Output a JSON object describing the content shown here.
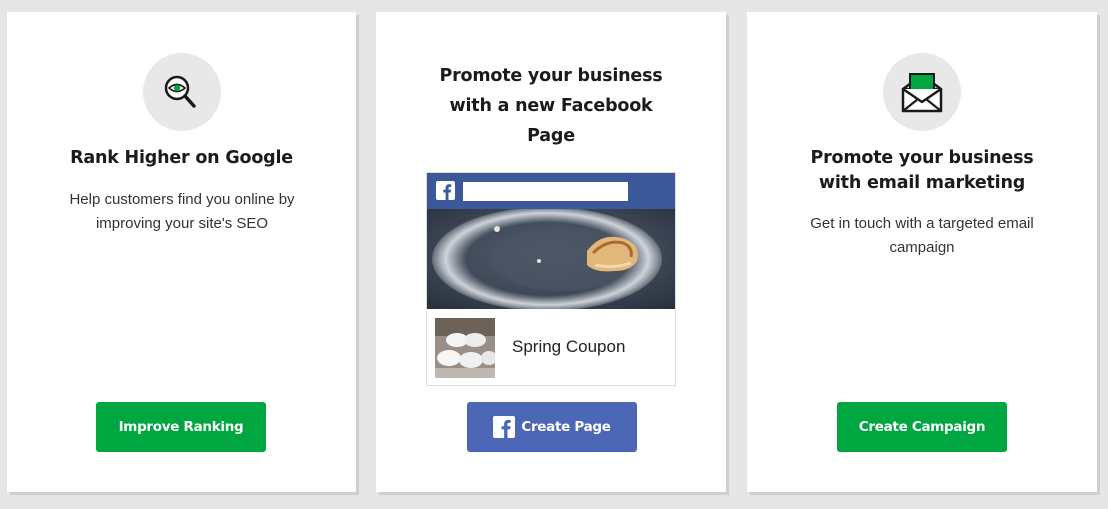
{
  "cards": [
    {
      "icon": "magnifier-eye-icon",
      "heading": "Rank Higher on Google",
      "description": "Help customers find you online by improving your site's SEO",
      "button_label": "Improve Ranking",
      "button_color": "#00a63f"
    },
    {
      "heading": "Promote your business with a new Facebook Page",
      "preview": {
        "coupon_label": "Spring Coupon"
      },
      "button_icon": "facebook-icon",
      "button_label": "Create Page",
      "button_color": "#4b67b5"
    },
    {
      "icon": "open-envelope-icon",
      "heading": "Promote your business with email marketing",
      "description": "Get in touch with a targeted email campaign",
      "button_label": "Create Campaign",
      "button_color": "#00a63f"
    }
  ],
  "colors": {
    "background": "#e6e6e6",
    "accent_green": "#00a63f",
    "facebook_blue": "#3b5998"
  }
}
